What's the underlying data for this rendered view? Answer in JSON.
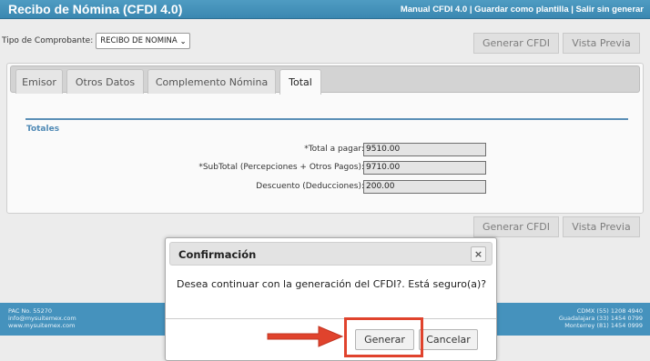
{
  "header": {
    "title": "Recibo de Nómina (CFDI 4.0)",
    "links": [
      "Manual CFDI 4.0",
      "Guardar como plantilla",
      "Salir sin generar"
    ],
    "separator": " | "
  },
  "tipo": {
    "label": "Tipo de Comprobante:",
    "selected": "RECIBO DE NOMINA"
  },
  "toolbar": {
    "generate_label": "Generar CFDI",
    "preview_label": "Vista Previa"
  },
  "tabs": [
    {
      "label": "Emisor",
      "active": false
    },
    {
      "label": "Otros Datos",
      "active": false
    },
    {
      "label": "Complemento Nómina",
      "active": false
    },
    {
      "label": "Total",
      "active": true
    }
  ],
  "totales": {
    "section_title": "Totales",
    "fields": [
      {
        "label": "*Total a pagar:",
        "value": "9510.00"
      },
      {
        "label": "*SubTotal (Percepciones + Otros Pagos):",
        "value": "9710.00"
      },
      {
        "label": "Descuento (Deducciones):",
        "value": "200.00"
      }
    ]
  },
  "footer": {
    "left": [
      "PAC No. 55270",
      "info@mysuitemex.com",
      "www.mysuitemex.com"
    ],
    "right": [
      "CDMX (55) 1208 4940",
      "Guadalajara (33) 1454 0799",
      "Monterrey (81) 1454 0999"
    ]
  },
  "dialog": {
    "title": "Confirmación",
    "close_symbol": "×",
    "message": "Desea continuar con la generación del CFDI?. Está seguro(a)?",
    "confirm_label": "Generar",
    "cancel_label": "Cancelar"
  },
  "colors": {
    "header": "#3f8fba",
    "footer": "#4592bd",
    "highlight": "#e0432d",
    "section_title": "#4f89b5"
  }
}
